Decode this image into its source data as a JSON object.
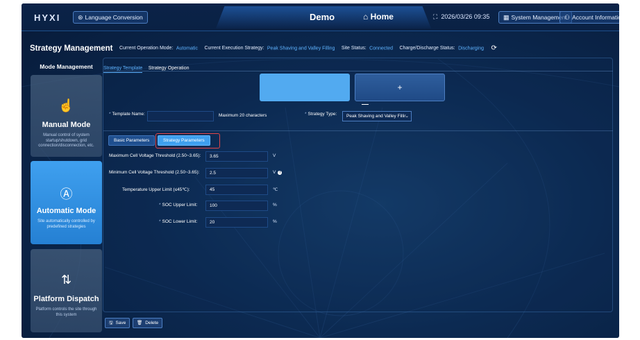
{
  "topbar": {
    "logo": "HYXI",
    "language_button": "Language Conversion",
    "site_title": "Demo",
    "home_label": "Home",
    "datetime": "2026/03/26 09:35",
    "system_management": "System Management",
    "account_information": "Account Information"
  },
  "header": {
    "title": "Strategy Management",
    "operation_mode_label": "Current Operation Mode:",
    "operation_mode_value": "Automatic",
    "execution_strategy_label": "Current Execution Strategy:",
    "execution_strategy_value": "Peak Shaving and Valley Filling",
    "site_status_label": "Site Status:",
    "site_status_value": "Connected",
    "charge_status_label": "Charge/Discharge Status:",
    "charge_status_value": "Discharging"
  },
  "sidebar": {
    "title": "Mode Management",
    "modes": [
      {
        "name": "Manual Mode",
        "description": "Manual control of system startup/shutdown, grid connection/disconnection, etc.",
        "icon": "hand-pointer-icon",
        "active": false
      },
      {
        "name": "Automatic Mode",
        "description": "Site automatically controlled by predefined strategies",
        "icon": "auto-mode-icon",
        "active": true
      },
      {
        "name": "Platform Dispatch",
        "description": "Platform controls the site through this system",
        "icon": "dispatch-icon",
        "active": false
      }
    ]
  },
  "tabs": {
    "template": "Strategy Template",
    "operation": "Strategy Operation",
    "active": "Strategy Template"
  },
  "template_cards": {
    "add_symbol": "+"
  },
  "form": {
    "template_name_label": "Template Name:",
    "template_name_value": "",
    "template_name_hint": "Maximum 20 characters",
    "strategy_type_label": "Strategy Type:",
    "strategy_type_value": "Peak Shaving and Valley Fillir"
  },
  "subtabs": {
    "basic": "Basic Parameters",
    "strategy": "Strategy Parameters",
    "active": "Strategy Parameters"
  },
  "parameters": [
    {
      "label": "Maximum Cell Voltage Threshold (2.50~3.65):",
      "value": "3.65",
      "unit": "V",
      "required": false
    },
    {
      "label": "Minimum Cell Voltage Threshold (2.50~3.65):",
      "value": "2.5",
      "unit": "V",
      "required": false,
      "info": true
    },
    {
      "label": "Temperature Upper Limit (≤45℃):",
      "value": "45",
      "unit": "℃",
      "required": false
    },
    {
      "label": "SOC Upper Limit:",
      "value": "100",
      "unit": "%",
      "required": true
    },
    {
      "label": "SOC Lower Limit:",
      "value": "20",
      "unit": "%",
      "required": true
    }
  ],
  "actions": {
    "save": "Save",
    "delete": "Delete"
  },
  "colors": {
    "accent": "#3fa0ef",
    "status_value": "#5fb3ff",
    "highlight_border": "#e2474a",
    "background": "#0c2a52"
  }
}
